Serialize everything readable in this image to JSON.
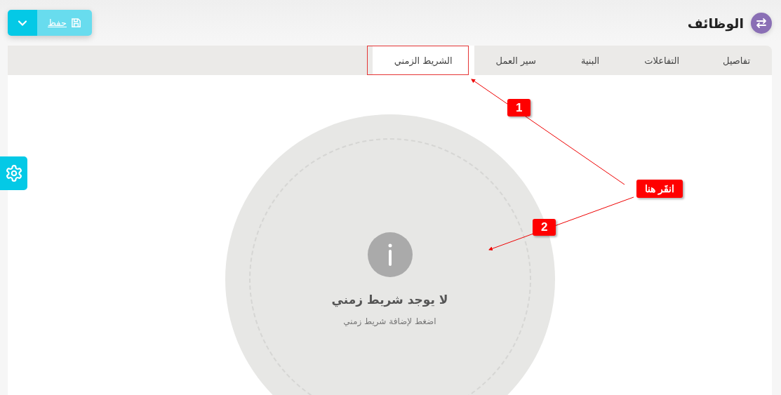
{
  "header": {
    "title": "الوظائف",
    "save_button": "حفظ"
  },
  "tabs": [
    {
      "label": "تفاصيل",
      "selected": false
    },
    {
      "label": "التفاعلات",
      "selected": false
    },
    {
      "label": "البنية",
      "selected": false
    },
    {
      "label": "سير العمل",
      "selected": false
    },
    {
      "label": "الشريط الزمني",
      "selected": true
    }
  ],
  "empty_state": {
    "title": "لا يوجد شريط زمني",
    "subtitle": "اضغط لإضافة شريط زمني"
  },
  "annotations": [
    {
      "label": "1"
    },
    {
      "label": "2"
    },
    {
      "label": "انقَر هنا"
    }
  ]
}
